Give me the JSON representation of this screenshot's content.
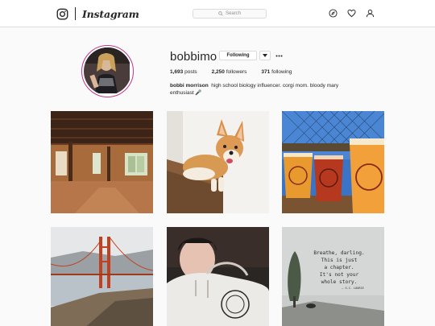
{
  "app": {
    "wordmark": "Instagram"
  },
  "nav": {
    "search_placeholder": "Search",
    "icons": [
      "compass-icon",
      "heart-icon",
      "user-icon"
    ]
  },
  "profile": {
    "username": "bobbimo",
    "following_label": "Following",
    "posts_count": "1,693",
    "posts_label": "posts",
    "followers_count": "2,250",
    "followers_label": "followers",
    "following_count": "371",
    "following_stat_label": "following",
    "full_name": "bobbi morrison",
    "bio": "high school biology influencer. corgi mom. bloody mary enthusiast 🎤"
  },
  "posts": [
    {
      "name": "post-loft-interior"
    },
    {
      "name": "post-corgi"
    },
    {
      "name": "post-beers"
    },
    {
      "name": "post-golden-gate"
    },
    {
      "name": "post-selfie-hoodie"
    },
    {
      "name": "post-quote",
      "quote_lines": [
        "Breathe, darling.",
        "This is just",
        "a chapter.",
        "It's not your",
        "whole story."
      ],
      "quote_author": "— S.C. LOURIE"
    }
  ],
  "colors": {
    "avatar_ring": "#c1358c",
    "border": "#dbdbdb",
    "background": "#fafafa"
  }
}
